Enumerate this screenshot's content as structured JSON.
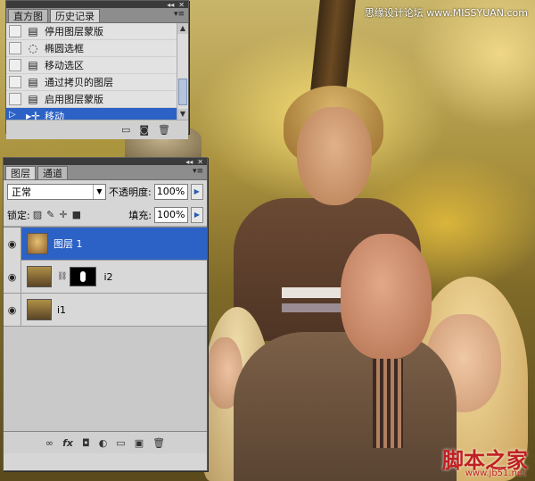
{
  "watermarks": {
    "top_right": "思缘设计论坛  www.MISSYUAN.com",
    "brand": "脚本之家",
    "url": "www.jb51.net"
  },
  "history_panel": {
    "tabs": [
      {
        "label": "直方图",
        "active": false
      },
      {
        "label": "历史记录",
        "active": true
      }
    ],
    "menu_icon": "panel-menu-icon",
    "items": [
      {
        "label": "停用图层蒙版",
        "icon": "history-state-icon",
        "selected": false
      },
      {
        "label": "椭圆选框",
        "icon": "ellipse-marquee-icon",
        "selected": false
      },
      {
        "label": "移动选区",
        "icon": "history-state-icon",
        "selected": false
      },
      {
        "label": "通过拷贝的图层",
        "icon": "history-state-icon",
        "selected": false
      },
      {
        "label": "启用图层蒙版",
        "icon": "history-state-icon",
        "selected": false
      },
      {
        "label": "移动",
        "icon": "move-tool-icon",
        "selected": true
      }
    ],
    "footer_icons": [
      "new-document-from-state-icon",
      "snapshot-camera-icon",
      "trash-icon"
    ]
  },
  "layers_panel": {
    "tabs": [
      {
        "label": "图层",
        "active": true
      },
      {
        "label": "通道",
        "active": false
      }
    ],
    "blend_mode": "正常",
    "opacity_label": "不透明度:",
    "opacity_value": "100%",
    "lock_label": "锁定:",
    "fill_label": "填充:",
    "fill_value": "100%",
    "layers": [
      {
        "name": "图层 1",
        "selected": true,
        "has_mask": false
      },
      {
        "name": "i2",
        "selected": false,
        "has_mask": true
      },
      {
        "name": "i1",
        "selected": false,
        "has_mask": false
      }
    ],
    "footer_icons": [
      "link-icon",
      "fx-icon",
      "mask-icon",
      "adjustment-icon",
      "group-folder-icon",
      "new-layer-icon",
      "trash-icon"
    ]
  },
  "colors": {
    "selection_blue": "#2c62c6",
    "panel_gray": "#d6d6d6"
  }
}
